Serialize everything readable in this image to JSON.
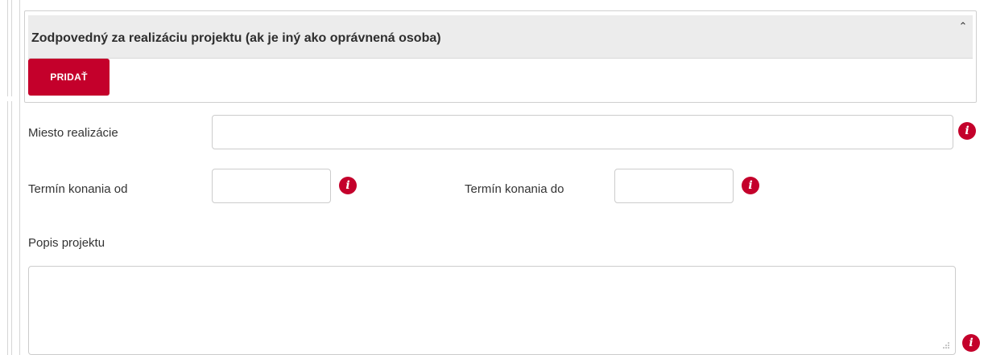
{
  "panel": {
    "title": "Zodpovedný za realizáciu projektu (ak je iný ako oprávnená osoba)",
    "collapse_icon": "chevron-up-icon",
    "add_button_label": "PRIDAŤ"
  },
  "form": {
    "place_label": "Miesto realizácie",
    "place_value": "",
    "date_from_label": "Termín konania od",
    "date_from_value": "",
    "date_to_label": "Termín konania do",
    "date_to_value": "",
    "description_label": "Popis projektu",
    "description_value": ""
  },
  "icons": {
    "info": "info-icon",
    "info_glyph": "i"
  },
  "colors": {
    "accent": "#c4002b",
    "panel_header_bg": "#ececec",
    "border": "#cccccc"
  }
}
